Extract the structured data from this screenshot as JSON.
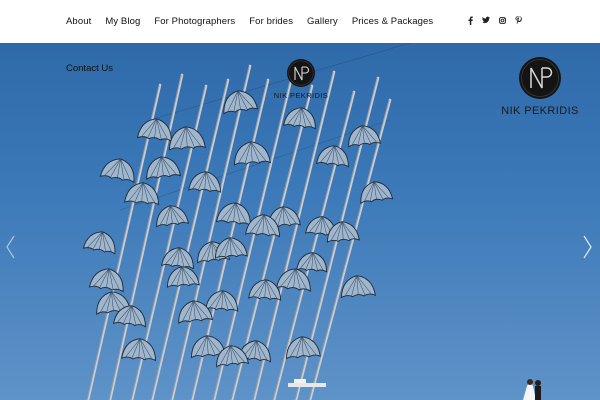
{
  "nav": {
    "items": [
      "About",
      "My Blog",
      "For Photographers",
      "For brides",
      "Gallery",
      "Prices & Packages"
    ],
    "second_row": "Contact Us"
  },
  "social": {
    "icons": [
      "facebook-icon",
      "twitter-icon",
      "instagram-icon",
      "pinterest-icon"
    ]
  },
  "logo": {
    "text": "NIK PEKRIDIS",
    "monogram": "NP"
  },
  "hero": {
    "alt": "Umbrellas sculpture under blue sky with wedding couple"
  },
  "colors": {
    "sky": "#3a78b8",
    "nav_bg": "#ffffff",
    "text": "#111111"
  }
}
